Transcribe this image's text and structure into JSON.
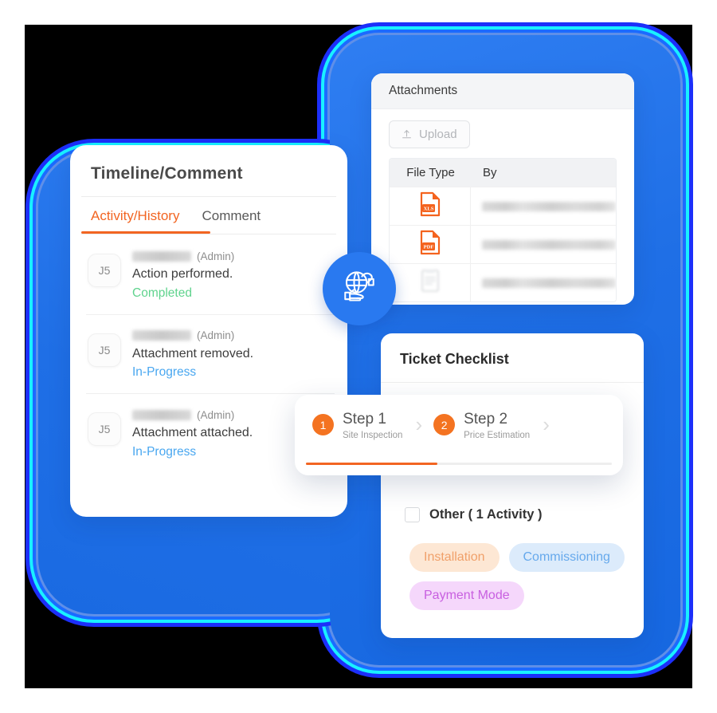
{
  "timeline": {
    "title": "Timeline/Comment",
    "tabs": [
      {
        "label": "Activity/History",
        "active": true
      },
      {
        "label": "Comment",
        "active": false
      }
    ],
    "items": [
      {
        "avatar": "J5",
        "user": "",
        "role": "(Admin)",
        "action": "Action performed.",
        "status": "Completed",
        "status_color": "#5fd38d"
      },
      {
        "avatar": "J5",
        "user": "",
        "role": "(Admin)",
        "action": "Attachment removed.",
        "status": "In-Progress",
        "status_color": "#49a7f0"
      },
      {
        "avatar": "J5",
        "user": "",
        "role": "(Admin)",
        "action": "Attachment attached.",
        "status": "In-Progress",
        "status_color": "#49a7f0"
      }
    ]
  },
  "attachments": {
    "title": "Attachments",
    "upload_label": "Upload",
    "upload_icon": "upload-icon",
    "columns": [
      "File Type",
      "By"
    ],
    "rows": [
      {
        "file_type": "XLS",
        "by": ""
      },
      {
        "file_type": "PDF",
        "by": ""
      },
      {
        "file_type": "DOC",
        "by": ""
      }
    ]
  },
  "checklist": {
    "title": "Ticket Checklist",
    "checkbox_label": "Other ( 1 Activity )",
    "checked": false,
    "chips": [
      {
        "label": "Installation",
        "style": "installation"
      },
      {
        "label": "Commissioning",
        "style": "commissioning"
      },
      {
        "label": "Payment Mode",
        "style": "payment"
      }
    ]
  },
  "stepper": {
    "steps": [
      {
        "num": "1",
        "label": "Step 1",
        "sub": "Site Inspection"
      },
      {
        "num": "2",
        "label": "Step 2",
        "sub": "Price Estimation"
      }
    ],
    "chevron": "›",
    "progress_percent": 43
  },
  "badge": {
    "icon": "hand-holding-globe-icon"
  },
  "colors": {
    "accent_orange": "#f26522",
    "brand_blue": "#2979f0",
    "status_completed": "#5fd38d",
    "status_inprogress": "#49a7f0",
    "glow_cyan": "#19f0ff",
    "glow_blue": "#1c2ffa"
  }
}
